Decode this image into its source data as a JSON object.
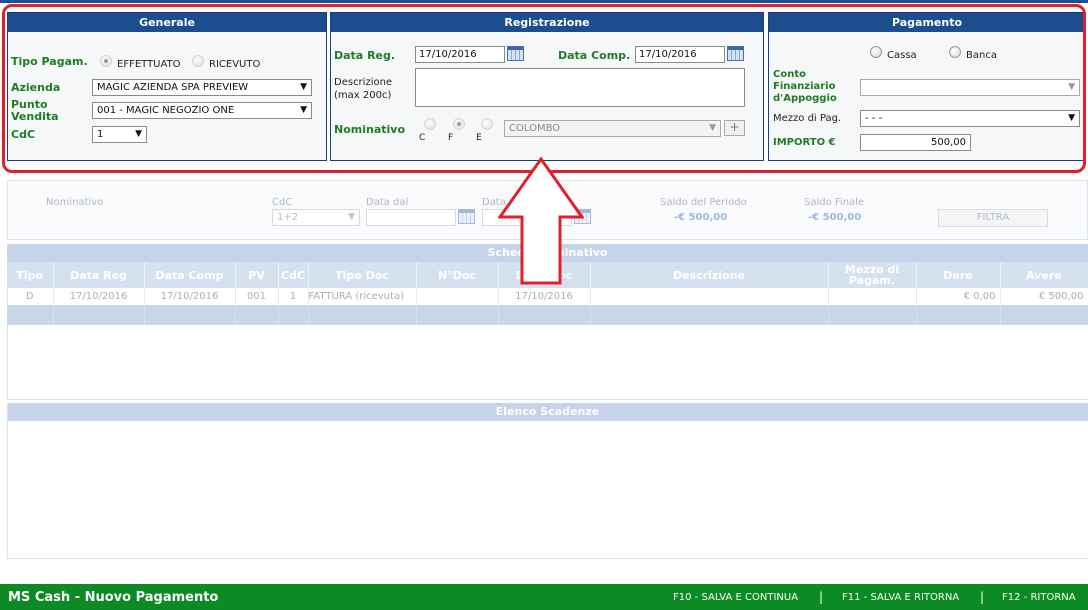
{
  "generale": {
    "title": "Generale",
    "tipo_pagam_label": "Tipo Pagam.",
    "effettuato_label": "EFFETTUATO",
    "ricevuto_label": "RICEVUTO",
    "azienda_label": "Azienda",
    "azienda_value": "MAGIC AZIENDA SPA PREVIEW",
    "punto_vendita_label_1": "Punto",
    "punto_vendita_label_2": "Vendita",
    "punto_vendita_value": "001 - MAGIC NEGOZIO ONE",
    "cdc_label": "CdC",
    "cdc_value": "1"
  },
  "registrazione": {
    "title": "Registrazione",
    "data_reg_label": "Data Reg.",
    "data_reg_value": "17/10/2016",
    "data_comp_label": "Data Comp.",
    "data_comp_value": "17/10/2016",
    "descrizione_label_1": "Descrizione",
    "descrizione_label_2": "(max 200c)",
    "nominativo_label": "Nominativo",
    "radio_c": "C",
    "radio_f": "F",
    "radio_e": "E",
    "nominativo_value": "COLOMBO",
    "add_label": "+"
  },
  "pagamento": {
    "title": "Pagamento",
    "cassa_label": "Cassa",
    "banca_label": "Banca",
    "conto_label_1": "Conto",
    "conto_label_2": "Finanziario",
    "conto_label_3": "d'Appoggio",
    "mezzo_label": "Mezzo di Pag.",
    "mezzo_value": "- - -",
    "importo_label": "IMPORTO €",
    "importo_value": "500,00"
  },
  "filtro": {
    "nominativo_label": "Nominativo",
    "cdc_label": "CdC",
    "cdc_value": "1+2",
    "data_dal_label": "Data dal",
    "data_al_label": "Data",
    "saldo_periodo_label": "Saldo del Periodo",
    "saldo_periodo_value": "-€ 500,00",
    "saldo_finale_label": "Saldo Finale",
    "saldo_finale_value": "-€ 500,00",
    "filtra_label": "FILTRA"
  },
  "schede": {
    "title": "Schede Nominativo",
    "columns": [
      "Tipo",
      "Data Reg",
      "Data Comp",
      "PV",
      "CdC",
      "Tipo Doc",
      "N°Doc",
      "Data Doc",
      "Descrizione",
      "Mezzo di Pagam.",
      "Dare",
      "Avere"
    ],
    "rows": [
      [
        "D",
        "17/10/2016",
        "17/10/2016",
        "001",
        "1",
        "FATTURA (ricevuta)",
        "",
        "17/10/2016",
        "",
        "",
        "€ 0,00",
        "€ 500,00"
      ]
    ]
  },
  "scadenze": {
    "title": "Elenco Scadenze"
  },
  "footer": {
    "title": "MS Cash - Nuovo Pagamento",
    "f10": "F10 - SALVA E CONTINUA",
    "f11": "F11 - SALVA E RITORNA",
    "f12": "F12 - RITORNA",
    "sep": "|"
  },
  "colors": {
    "panel_header": "#1c4d8f",
    "label_green": "#1e7d22",
    "footer_green": "#0c8a24",
    "highlight_red": "#e0202a"
  }
}
